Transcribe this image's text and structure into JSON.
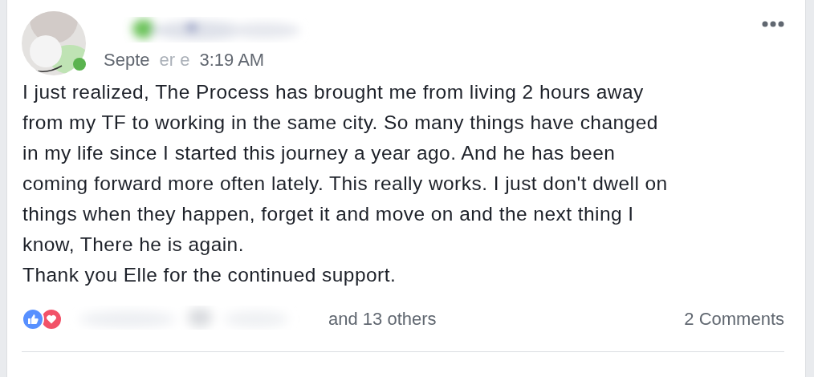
{
  "post": {
    "header": {
      "timestamp_parts": [
        "Septe",
        "er e",
        "3:19 AM"
      ]
    },
    "body": [
      {
        "lines": [
          "I just realized, The Process has brought me from living 2 hours away",
          "from my TF to working in the same city. So many things have changed",
          "in my life since I started this journey a year ago. And he has been",
          "coming forward more often lately. This really works. I just don't dwell on",
          "things when they happen, forget it and move on and the next thing I",
          "know, There he is again."
        ]
      },
      {
        "lines": [
          "Thank you Elle for the continued support."
        ]
      }
    ],
    "footer": {
      "reactions": [
        {
          "kind": "like",
          "color": "#5890ff"
        },
        {
          "kind": "love",
          "color": "#f25268"
        }
      ],
      "others": "and 13 others",
      "comments": "2 Comments"
    }
  }
}
